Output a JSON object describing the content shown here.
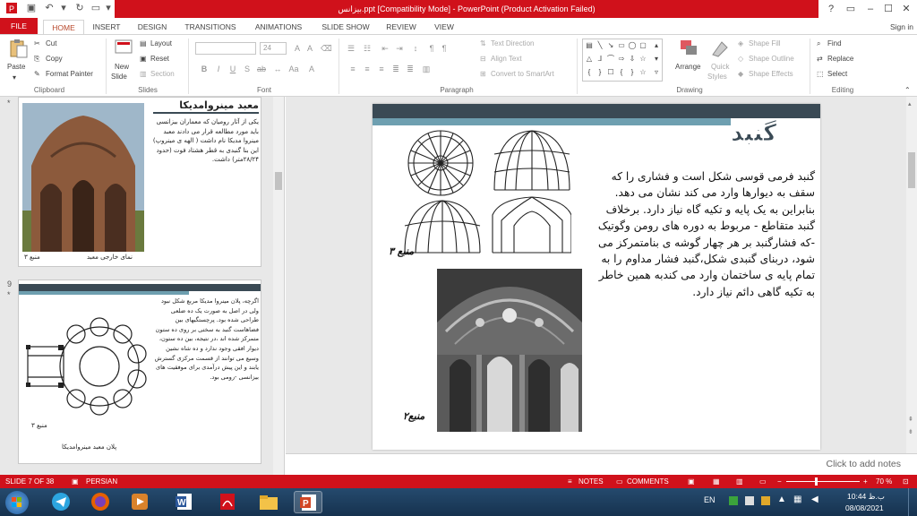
{
  "titlebar": {
    "title": "بیزانس.ppt [Compatibility Mode] - PowerPoint (Product Activation Failed)",
    "help": "?",
    "min": "–",
    "max": "☐",
    "close": "✕"
  },
  "tabs": [
    "FILE",
    "HOME",
    "INSERT",
    "DESIGN",
    "TRANSITIONS",
    "ANIMATIONS",
    "SLIDE SHOW",
    "REVIEW",
    "VIEW"
  ],
  "signin": "Sign in",
  "ribbon": {
    "clipboard": {
      "label": "Clipboard",
      "paste": "Paste",
      "cut": "Cut",
      "copy": "Copy",
      "format_painter": "Format Painter"
    },
    "slides": {
      "label": "Slides",
      "new_slide_1": "New",
      "new_slide_2": "Slide",
      "layout": "Layout",
      "reset": "Reset",
      "section": "Section"
    },
    "font": {
      "label": "Font",
      "size": "24"
    },
    "paragraph": {
      "label": "Paragraph",
      "text_direction": "Text Direction",
      "align_text": "Align Text",
      "convert_smartart": "Convert to SmartArt"
    },
    "drawing": {
      "label": "Drawing",
      "arrange": "Arrange",
      "quick_styles_1": "Quick",
      "quick_styles_2": "Styles",
      "shape_fill": "Shape Fill",
      "shape_outline": "Shape Outline",
      "shape_effects": "Shape Effects"
    },
    "editing": {
      "label": "Editing",
      "find": "Find",
      "replace": "Replace",
      "select": "Select"
    }
  },
  "thumbnails": {
    "slide8": {
      "star": "*",
      "title": "معبد مینروامدیکا",
      "body": "یکی از آثار رومیان که معماران بیزانسی باید مورد مطالعه قرار می دادند معبد مینروا مدیکا نام داشت ( الهه ی مینروپ) این بنا گنبدی به قطر هشتاد فوت (حدود ۲۸/۲۴متر) داشت.",
      "ref": "منبع ۳",
      "caption": "نمای خارجی معبد"
    },
    "slide9": {
      "num": "9",
      "star": "*",
      "body": "اگرچه، پلان مینروا مدیکا مربع شکل نبود ولی در اصل به صورت یک ده ضلعی طراحی شده بود. پرچستگیهای بین فضاهاست گنبد به سختی بر روی ده ستون متمرکز شده اند ،در نتیجه، بین ده ستون، دیوار افقی وجود ندارد و ده شاه نشین وسیع می توانند از قسمت مرکزی گسترش یابند و این پیش درآمدی برای موفقیت های بیزانسی -رومی بود.",
      "ref": "منبع ۳",
      "caption": "پلان معبد مینروامدیکا"
    }
  },
  "slide": {
    "title": "گنبد",
    "body": "گنبد فرمی قوسی شکل است و فشاری را که سقف به دیوارها وارد می کند نشان می دهد. بنابراین به یک پایه و تکیه گاه نیاز دارد. برخلاف گنبد متقاطع - مربوط به دوره های رومن وگوتیک -که فشارگنبد بر هر چهار گوشه ی بنامتمرکز می شود، دربنای گنبدی شکل،گنبد فشار مداوم را به تمام پایه ی ساختمان وارد می کندبه همین خاطر به تکیه گاهی دائم نیاز دارد.",
    "ref3": "منبع ۳",
    "ref2": "منبع۲"
  },
  "notes_placeholder": "Click to add notes",
  "status": {
    "slide": "SLIDE 7 OF 38",
    "language": "PERSIAN",
    "notes": "NOTES",
    "comments": "COMMENTS",
    "zoom": "70 %"
  },
  "taskbar": {
    "lang": "EN",
    "time": "10:44 ب.ظ",
    "date": "08/08/2021"
  },
  "colors": {
    "accent": "#d0111b",
    "slide_band_dark": "#3a4a55",
    "slide_band_teal": "#6e9fb0"
  }
}
